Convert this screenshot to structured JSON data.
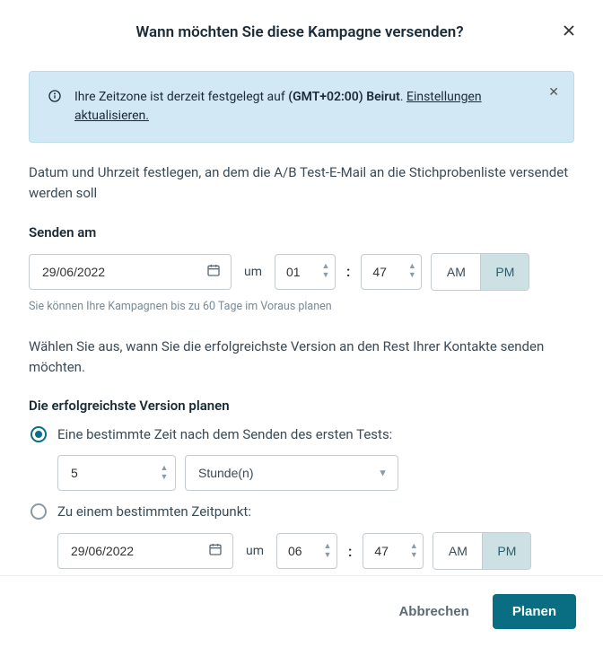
{
  "header": {
    "title": "Wann möchten Sie diese Kampagne versenden?"
  },
  "alert": {
    "prefix": "Ihre Zeitzone ist derzeit festgelegt auf ",
    "timezone": "(GMT+02:00) Beirut",
    "dot": ". ",
    "link": "Einstellungen aktualisieren."
  },
  "intro": "Datum und Uhrzeit festlegen, an dem die A/B Test-E-Mail an die Stichprobenliste versendet werden soll",
  "send": {
    "label": "Senden am",
    "date": "29/06/2022",
    "um": "um",
    "hour": "01",
    "minute": "47",
    "am": "AM",
    "pm": "PM",
    "note": "Sie können Ihre Kampagnen bis zu 60 Tage im Voraus planen"
  },
  "winner_intro": "Wählen Sie aus, wann Sie die erfolgreichste Version an den Rest Ihrer Kontakte senden möchten.",
  "winner": {
    "label": "Die erfolgreichste Version planen",
    "opt1": "Eine bestimmte Zeit nach dem Senden des ersten Tests:",
    "opt1_value": "5",
    "opt1_unit": "Stunde(n)",
    "opt2": "Zu einem bestimmten Zeitpunkt:",
    "opt2_date": "29/06/2022",
    "opt2_um": "um",
    "opt2_hour": "06",
    "opt2_minute": "47",
    "opt2_am": "AM",
    "opt2_pm": "PM"
  },
  "footer": {
    "cancel": "Abbrechen",
    "submit": "Planen"
  }
}
